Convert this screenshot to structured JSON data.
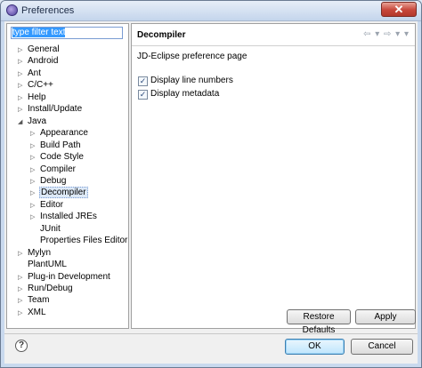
{
  "window": {
    "title": "Preferences",
    "close_glyph": "✕"
  },
  "filter": {
    "value": "type filter text"
  },
  "tree": [
    {
      "label": "General",
      "expander": "▷"
    },
    {
      "label": "Android",
      "expander": "▷"
    },
    {
      "label": "Ant",
      "expander": "▷"
    },
    {
      "label": "C/C++",
      "expander": "▷"
    },
    {
      "label": "Help",
      "expander": "▷"
    },
    {
      "label": "Install/Update",
      "expander": "▷"
    },
    {
      "label": "Java",
      "expander": "◢"
    },
    {
      "label": "Appearance",
      "expander": "▷"
    },
    {
      "label": "Build Path",
      "expander": "▷"
    },
    {
      "label": "Code Style",
      "expander": "▷"
    },
    {
      "label": "Compiler",
      "expander": "▷"
    },
    {
      "label": "Debug",
      "expander": "▷"
    },
    {
      "label": "Decompiler",
      "expander": "▷"
    },
    {
      "label": "Editor",
      "expander": "▷"
    },
    {
      "label": "Installed JREs",
      "expander": "▷"
    },
    {
      "label": "JUnit",
      "expander": ""
    },
    {
      "label": "Properties Files Editor",
      "expander": ""
    },
    {
      "label": "Mylyn",
      "expander": "▷"
    },
    {
      "label": "PlantUML",
      "expander": ""
    },
    {
      "label": "Plug-in Development",
      "expander": "▷"
    },
    {
      "label": "Run/Debug",
      "expander": "▷"
    },
    {
      "label": "Team",
      "expander": "▷"
    },
    {
      "label": "XML",
      "expander": "▷"
    }
  ],
  "selected_item": "Decompiler",
  "page": {
    "title": "Decompiler",
    "nav_glyphs": "⇦ ▾ ⇨ ▾ ▾",
    "description": "JD-Eclipse preference page",
    "options": [
      {
        "label": "Display line numbers",
        "checked": true
      },
      {
        "label": "Display metadata",
        "checked": true
      }
    ],
    "check_glyph": "✓",
    "restore_defaults_label": "Restore Defaults",
    "apply_label": "Apply"
  },
  "footer": {
    "help_glyph": "?",
    "ok_label": "OK",
    "cancel_label": "Cancel"
  },
  "colors": {
    "selection": "#3399ff",
    "default_button": "#bee6fd",
    "close_button": "#c7463a"
  }
}
